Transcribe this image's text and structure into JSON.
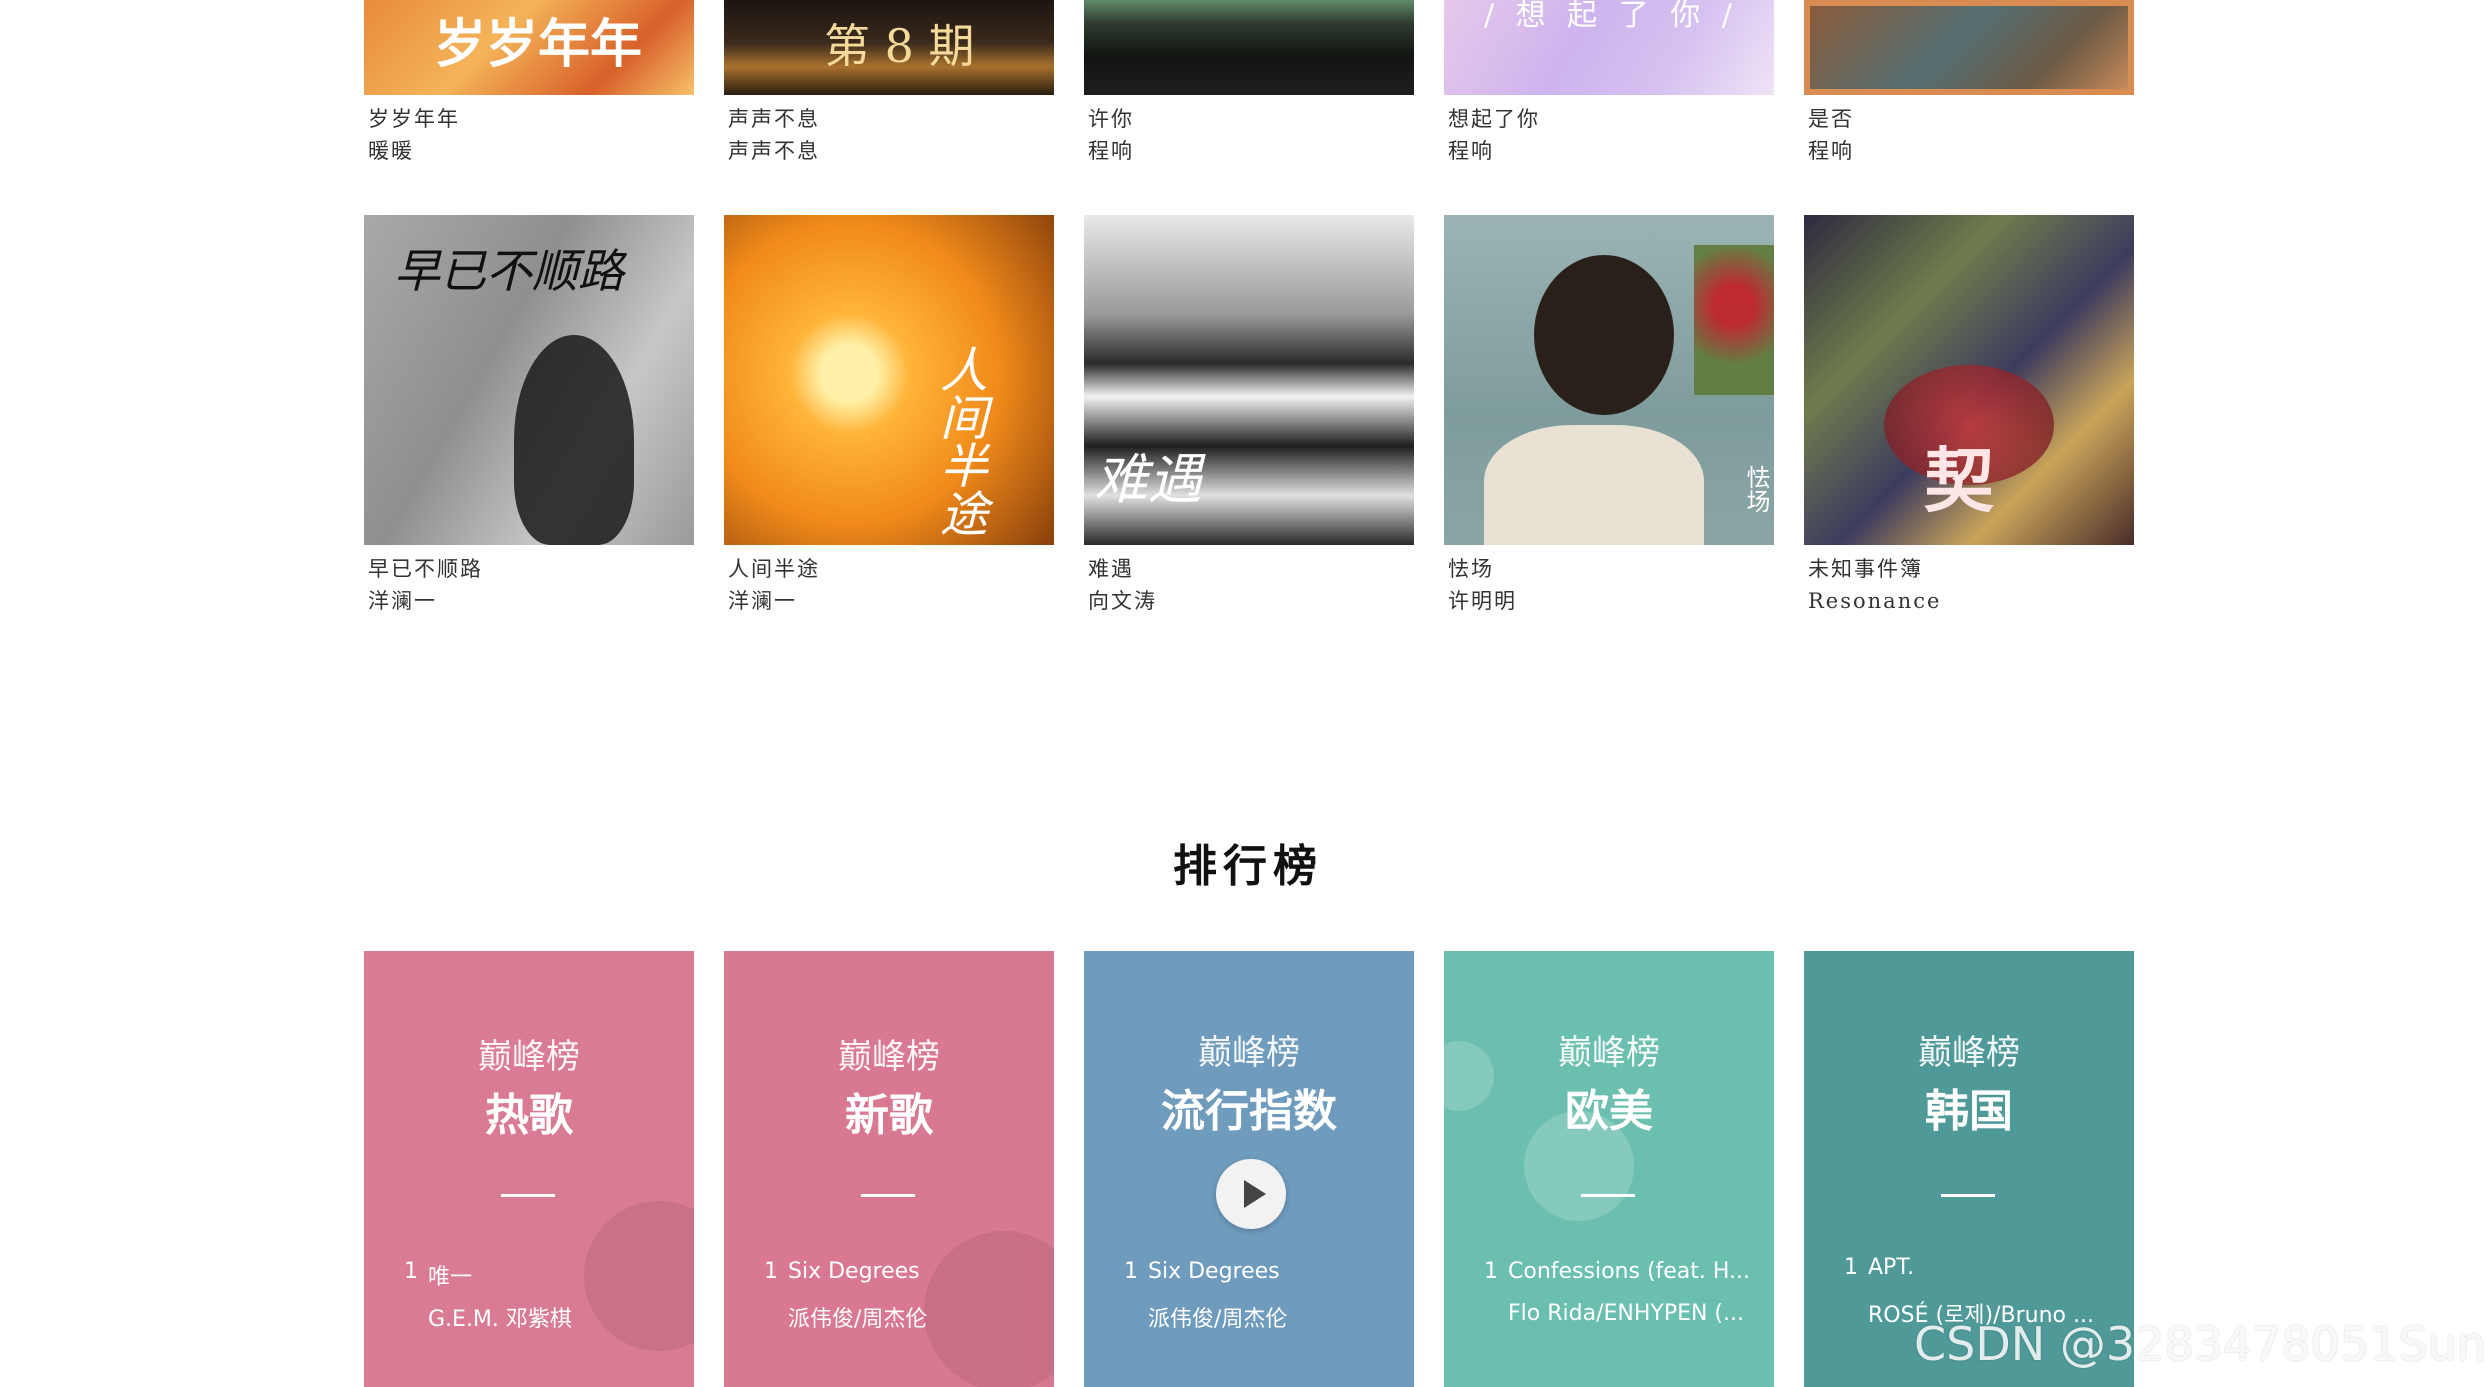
{
  "albums_row1": [
    {
      "cover_text": "岁岁年年",
      "title": "岁岁年年",
      "artist": "暖暖"
    },
    {
      "cover_text": "第 8 期",
      "title": "声声不息",
      "artist": "声声不息"
    },
    {
      "cover_text": "",
      "title": "许你",
      "artist": "程响"
    },
    {
      "cover_text": "/ 想 起 了 你 /",
      "title": "想起了你",
      "artist": "程响"
    },
    {
      "cover_text": "",
      "title": "是否",
      "artist": "程响"
    }
  ],
  "albums_row2": [
    {
      "cover_text": "早已不顺路",
      "title": "早已不顺路",
      "artist": "洋澜一"
    },
    {
      "cover_text": "人间半途",
      "title": "人间半途",
      "artist": "洋澜一"
    },
    {
      "cover_text": "难遇",
      "title": "难遇",
      "artist": "向文涛"
    },
    {
      "cover_text": "怯场",
      "title": "怯场",
      "artist": "许明明"
    },
    {
      "cover_text": "契",
      "title": "未知事件簿",
      "artist": "Resonance"
    }
  ],
  "section_title": "排行榜",
  "rank_cards": [
    {
      "label": "巅峰榜",
      "name": "热歌",
      "num": "1",
      "song": "唯一",
      "artist": "G.E.M. 邓紫棋",
      "color": "#d97b93"
    },
    {
      "label": "巅峰榜",
      "name": "新歌",
      "num": "1",
      "song": "Six Degrees",
      "artist": "派伟俊/周杰伦",
      "color": "#d97891"
    },
    {
      "label": "巅峰榜",
      "name": "流行指数",
      "num": "1",
      "song": "Six Degrees",
      "artist": "派伟俊/周杰伦",
      "color": "#6f9bbc"
    },
    {
      "label": "巅峰榜",
      "name": "欧美",
      "num": "1",
      "song": "Confessions (feat. H...",
      "artist": "Flo Rida/ENHYPEN (...",
      "color": "#6bbfae"
    },
    {
      "label": "巅峰榜",
      "name": "韩国",
      "num": "1",
      "song": "APT.",
      "artist": "ROSÉ (로제)/Bruno ...",
      "color": "#4f9a99"
    }
  ],
  "watermark": "CSDN @3283478051Sun"
}
